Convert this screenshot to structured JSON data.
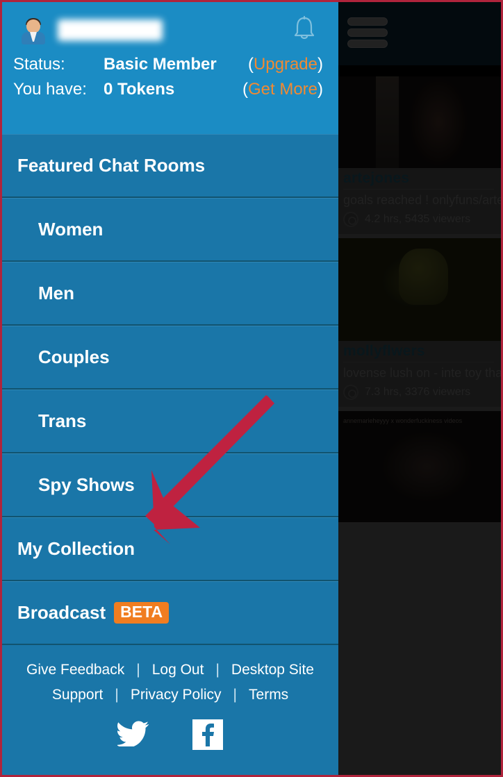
{
  "header": {
    "username": "xxxxxxxxx",
    "avatar_icon": "person-avatar-icon",
    "bell_icon": "notification-bell-icon",
    "status_label": "Status:",
    "status_value": "Basic Member",
    "upgrade_open": "(",
    "upgrade_link": "Upgrade",
    "upgrade_close": ")",
    "tokens_label": "You have:",
    "tokens_value": "0 Tokens",
    "getmore_open": "(",
    "getmore_link": "Get More",
    "getmore_close": ")"
  },
  "nav": {
    "items": [
      {
        "label": "Featured Chat Rooms",
        "sub": false
      },
      {
        "label": "Women",
        "sub": true
      },
      {
        "label": "Men",
        "sub": true
      },
      {
        "label": "Couples",
        "sub": true
      },
      {
        "label": "Trans",
        "sub": true
      },
      {
        "label": "Spy Shows",
        "sub": true
      },
      {
        "label": "My Collection",
        "sub": false
      },
      {
        "label": "Broadcast",
        "sub": false,
        "badge": "BETA"
      }
    ]
  },
  "footer": {
    "row1": [
      {
        "label": "Give Feedback"
      },
      {
        "label": "Log Out"
      },
      {
        "label": "Desktop Site"
      }
    ],
    "row2": [
      {
        "label": "Support"
      },
      {
        "label": "Privacy Policy"
      },
      {
        "label": "Terms"
      }
    ],
    "separator": "|",
    "social": [
      {
        "name": "twitter-icon"
      },
      {
        "name": "facebook-icon"
      }
    ]
  },
  "right_panel": {
    "hamburger_icon": "hamburger-menu-icon",
    "cards": [
      {
        "name": "artejones",
        "description": "goals reached ! onlyfuns/artejones",
        "stats": "4.2 hrs, 5435 viewers",
        "cam_icon": "webcam-icon"
      },
      {
        "name": "mollyflwers",
        "description": "lovense lush on - inte toy that vibrates wit",
        "stats": "7.3 hrs, 3376 viewers",
        "cam_icon": "webcam-icon"
      },
      {
        "name": "",
        "description": "",
        "stats": "",
        "cam_icon": "webcam-icon",
        "overlay_label": "annemarieheyyy\nx wonderfuckiness videos"
      }
    ]
  },
  "annotation": {
    "arrow_color": "#bf2240",
    "points_to": "My Collection"
  },
  "colors": {
    "header_blue": "#1b8cc4",
    "menu_blue": "#1a76a8",
    "accent_orange": "#f08a33",
    "beta_orange": "#f07d20",
    "border_red": "#b0243c"
  }
}
